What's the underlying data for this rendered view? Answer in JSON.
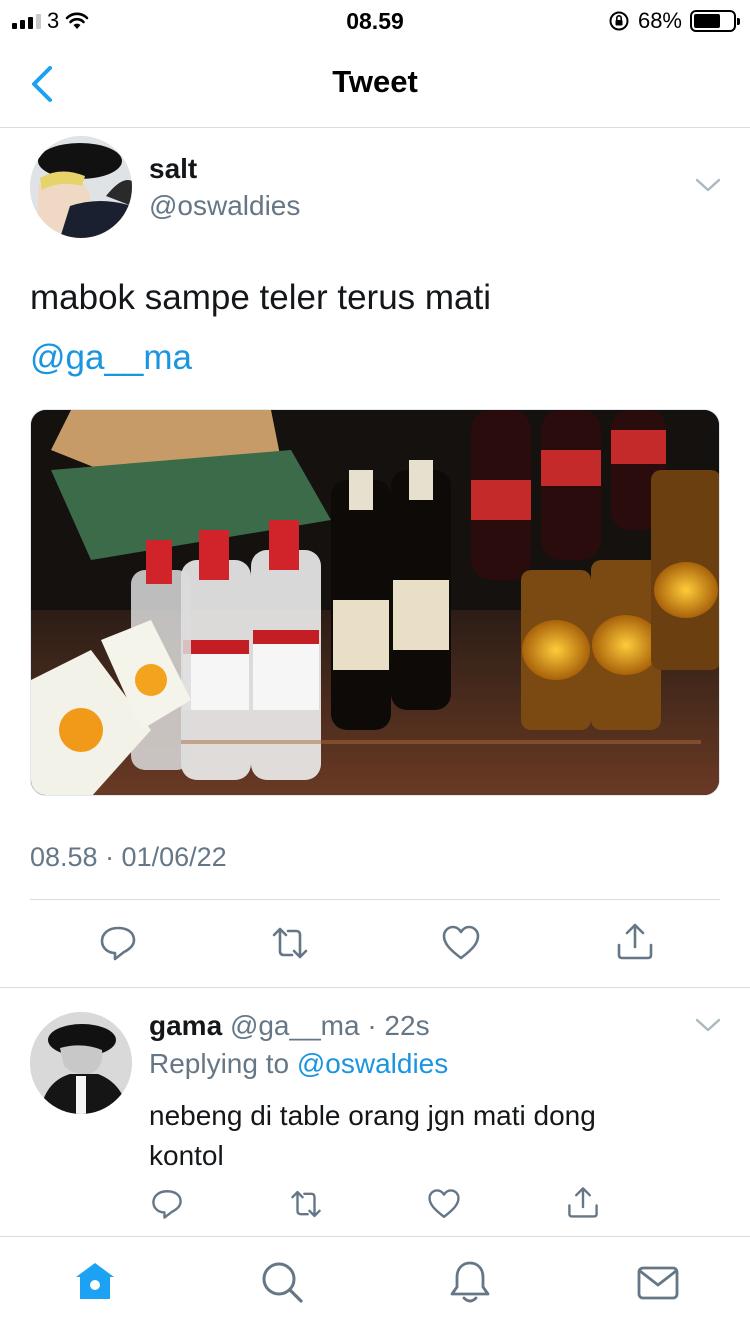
{
  "status_bar": {
    "carrier": "3",
    "time": "08.59",
    "battery_percent": "68%",
    "battery_level": 0.68,
    "signal_bars": 3
  },
  "nav": {
    "title": "Tweet",
    "back_icon": "chevron-left-icon"
  },
  "tweet": {
    "author_name": "salt",
    "author_handle": "@oswaldies",
    "text": "mabok sampe teler terus mati",
    "mention": "@ga__ma",
    "timestamp": "08.58 · 01/06/22",
    "actions": [
      "reply-icon",
      "retweet-icon",
      "like-icon",
      "share-icon"
    ]
  },
  "reply": {
    "author_name": "gama",
    "author_meta": "@ga__ma · 22s",
    "replying_label": "Replying to",
    "replying_to": "@oswaldies",
    "text": "nebeng di table orang jgn mati dong kontol"
  },
  "tab_bar": {
    "items": [
      "home-icon",
      "search-icon",
      "notifications-icon",
      "messages-icon"
    ]
  },
  "colors": {
    "accent": "#1b95e0",
    "secondary_text": "#657786",
    "divider": "#d8dde1"
  }
}
